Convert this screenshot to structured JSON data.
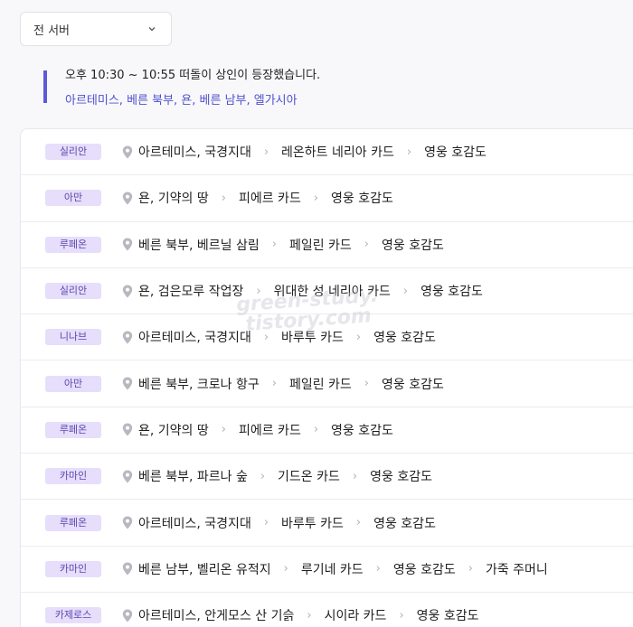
{
  "server_select": {
    "label": "전 서버",
    "icon": "chevron-down-icon"
  },
  "notice": {
    "text": "오후 10:30 ~ 10:55 떠돌이 상인이 등장했습니다.",
    "locations": "아르테미스, 베른 북부, 욘, 베른 남부, 엘가시아",
    "accent_color": "#5b5bd6"
  },
  "merchants": [
    {
      "name": "실리안",
      "location": "아르테미스, 국경지대",
      "items": [
        "레온하트 네리아 카드",
        "영웅 호감도"
      ]
    },
    {
      "name": "아만",
      "location": "욘, 기약의 땅",
      "items": [
        "피에르 카드",
        "영웅 호감도"
      ]
    },
    {
      "name": "루페온",
      "location": "베른 북부, 베르닐 삼림",
      "items": [
        "페일린 카드",
        "영웅 호감도"
      ]
    },
    {
      "name": "실리안",
      "location": "욘, 검은모루 작업장",
      "items": [
        "위대한 성 네리아 카드",
        "영웅 호감도"
      ]
    },
    {
      "name": "니나브",
      "location": "아르테미스, 국경지대",
      "items": [
        "바루투 카드",
        "영웅 호감도"
      ]
    },
    {
      "name": "아만",
      "location": "베른 북부, 크로나 항구",
      "items": [
        "페일린 카드",
        "영웅 호감도"
      ]
    },
    {
      "name": "루페온",
      "location": "욘, 기약의 땅",
      "items": [
        "피에르 카드",
        "영웅 호감도"
      ]
    },
    {
      "name": "카마인",
      "location": "베른 북부, 파르나 숲",
      "items": [
        "기드온 카드",
        "영웅 호감도"
      ]
    },
    {
      "name": "루페온",
      "location": "아르테미스, 국경지대",
      "items": [
        "바루투 카드",
        "영웅 호감도"
      ]
    },
    {
      "name": "카마인",
      "location": "베른 남부, 벨리온 유적지",
      "items": [
        "루기네 카드",
        "영웅 호감도",
        "가죽 주머니"
      ]
    },
    {
      "name": "카제로스",
      "location": "아르테미스, 안게모스 산 기슭",
      "items": [
        "시이라 카드",
        "영웅 호감도"
      ]
    }
  ],
  "watermark": {
    "line1": "green-study.",
    "line2": "tistory.com"
  },
  "colors": {
    "badge_bg": "#e6defa",
    "badge_text": "#5a48b0",
    "link": "#4f4fd0"
  },
  "icons": {
    "location": "map-pin-icon",
    "separator": "chevron-right-icon"
  }
}
